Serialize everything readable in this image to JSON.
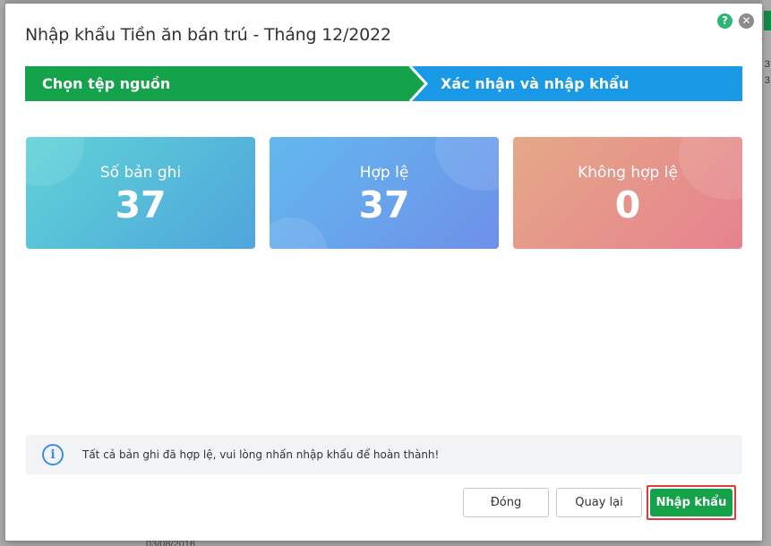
{
  "dialog": {
    "title": "Nhập khẩu Tiền ăn bán trú - Tháng 12/2022",
    "help_icon": "?",
    "close_icon": "✕"
  },
  "steps": [
    {
      "label": "Chọn tệp nguồn",
      "color": "#14a34b"
    },
    {
      "label": "Xác nhận và nhập khẩu",
      "color": "#1a9ae6"
    }
  ],
  "stats": [
    {
      "label": "Số bản ghi",
      "value": "37"
    },
    {
      "label": "Hợp lệ",
      "value": "37"
    },
    {
      "label": "Không hợp lệ",
      "value": "0"
    }
  ],
  "info": {
    "icon": "i",
    "message": "Tất cả bản ghi đã hợp lệ, vui lòng nhấn nhập khẩu để hoàn thành!"
  },
  "buttons": {
    "close_label": "Đóng",
    "back_label": "Quay lại",
    "import_label": "Nhập khẩu"
  },
  "background": {
    "right_num_1": "3",
    "right_num_2": "3",
    "bottom_text": "03/08/2016"
  }
}
